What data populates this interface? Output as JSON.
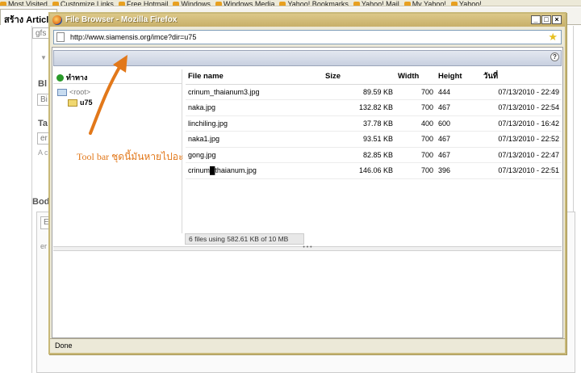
{
  "bookmarks": [
    "Most Visited",
    "Customize Links",
    "Free Hotmail",
    "Windows",
    "Windows Media",
    "Yahoo! Bookmarks",
    "Yahoo! Mail",
    "My Yahoo!",
    "Yahoo!"
  ],
  "background": {
    "tab_title": "สร้าง Article",
    "field1": "gfs",
    "label_bl": "Bl",
    "field_bl": "Bi",
    "label_ta": "Ta",
    "field_ta": "er",
    "grey_text": "A c",
    "label_bod": "Bod",
    "field_e": "E",
    "field_er": "er"
  },
  "window": {
    "title": "File Browser - Mozilla Firefox",
    "url": "http://www.siamensis.org/imce?dir=u75",
    "status": "Done"
  },
  "toolbar": {
    "help": "?"
  },
  "nav": {
    "header": "ทำทาง",
    "root": "<root>",
    "folder": "u75"
  },
  "file_table": {
    "headers": {
      "name": "File name",
      "size": "Size",
      "width": "Width",
      "height": "Height",
      "date": "วันที่"
    },
    "rows": [
      {
        "name": "crinum_thaianum3.jpg",
        "size": "89.59 KB",
        "width": "700",
        "height": "444",
        "date": "07/13/2010 - 22:49"
      },
      {
        "name": "naka.jpg",
        "size": "132.82 KB",
        "width": "700",
        "height": "467",
        "date": "07/13/2010 - 22:54"
      },
      {
        "name": "linchiling.jpg",
        "size": "37.78 KB",
        "width": "400",
        "height": "600",
        "date": "07/13/2010 - 16:42"
      },
      {
        "name": "naka1.jpg",
        "size": "93.51 KB",
        "width": "700",
        "height": "467",
        "date": "07/13/2010 - 22:52"
      },
      {
        "name": "gong.jpg",
        "size": "82.85 KB",
        "width": "700",
        "height": "467",
        "date": "07/13/2010 - 22:47"
      },
      {
        "name": "crinum█thaianum.jpg",
        "size": "146.06 KB",
        "width": "700",
        "height": "396",
        "date": "07/13/2010 - 22:51"
      }
    ]
  },
  "file_status": "6 files using 582.61 KB of 10 MB",
  "annotation": "Tool bar ชุดนี้มันหายไปอะ"
}
